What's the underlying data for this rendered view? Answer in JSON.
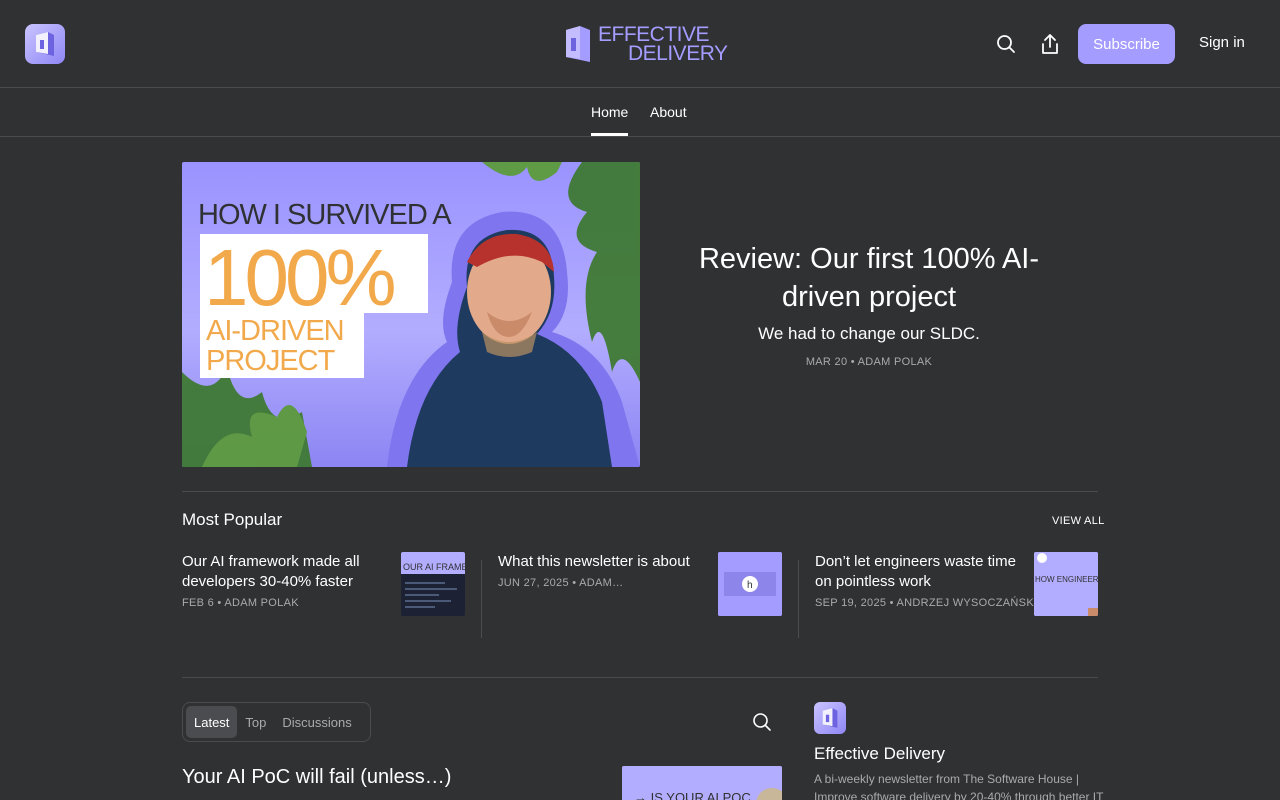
{
  "header": {
    "logo_line1": "EFFECTIVE",
    "logo_line2": "DELIVERY",
    "subscribe_label": "Subscribe",
    "signin_label": "Sign in",
    "brand_color": "#a59cff"
  },
  "nav": {
    "tabs": [
      {
        "label": "Home",
        "active": true
      },
      {
        "label": "About",
        "active": false
      }
    ]
  },
  "hero": {
    "image_text": {
      "line1": "HOW I SURVIVED A",
      "big": "100%",
      "line3": "AI-DRIVEN",
      "line4": "PROJECT"
    },
    "title": "Review: Our first 100% AI-driven project",
    "subtitle": "We had to change our SLDC.",
    "meta": "MAR 20 • ADAM POLAK"
  },
  "most_popular": {
    "heading": "Most Popular",
    "view_all": "VIEW ALL",
    "items": [
      {
        "title": "Our AI framework made all developers 30-40% faster",
        "meta": "FEB 6 • ADAM POLAK",
        "thumb_text": "OUR AI FRAMEW"
      },
      {
        "title": "What this newsletter is about",
        "meta": "JUN 27, 2025 • ADAM…",
        "thumb_text": ""
      },
      {
        "title": "Don’t let engineers waste time on pointless work",
        "meta": "SEP 19, 2025 • ANDRZEJ WYSOCZAŃSKI",
        "thumb_text": "HOW ENGINEERS CAN WASTE TIME"
      }
    ]
  },
  "latest": {
    "tabs": [
      {
        "label": "Latest",
        "active": true
      },
      {
        "label": "Top",
        "active": false
      },
      {
        "label": "Discussions",
        "active": false
      }
    ],
    "first_post_title": "Your AI PoC will fail (unless…)",
    "first_post_thumb_text": "→ IS YOUR AI POC"
  },
  "sidebar": {
    "name": "Effective Delivery",
    "description": "A bi-weekly newsletter from The Software House | Improve software delivery by 20-40% through better IT"
  }
}
